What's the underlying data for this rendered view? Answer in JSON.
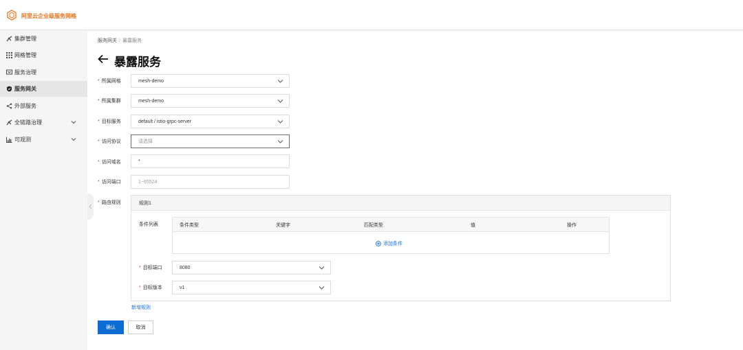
{
  "header": {
    "brand": "阿里云企业级服务网格",
    "brand_color": "#e8741f",
    "logo_icon": "hexagon-logo-icon"
  },
  "sidebar": {
    "items": [
      {
        "label": "集群管理",
        "icon": "cluster-icon",
        "active": false,
        "expandable": false
      },
      {
        "label": "网格管理",
        "icon": "grid-icon",
        "active": false,
        "expandable": false
      },
      {
        "label": "服务治理",
        "icon": "service-icon",
        "active": false,
        "expandable": false
      },
      {
        "label": "服务网关",
        "icon": "shield-icon",
        "active": true,
        "expandable": false
      },
      {
        "label": "外部服务",
        "icon": "share-icon",
        "active": false,
        "expandable": false
      },
      {
        "label": "全链路治理",
        "icon": "cluster-icon",
        "active": false,
        "expandable": true
      },
      {
        "label": "可观测",
        "icon": "chart-icon",
        "active": false,
        "expandable": true
      }
    ]
  },
  "breadcrumb": {
    "parent": "服务网关",
    "separator": "/",
    "current": "暴露服务"
  },
  "page": {
    "title": "暴露服务"
  },
  "form": {
    "mesh": {
      "label": "所属网格",
      "value": "mesh-demo"
    },
    "cluster": {
      "label": "所属集群",
      "value": "mesh-demo"
    },
    "target_service": {
      "label": "目标服务",
      "value": "default / istio-grpc-server"
    },
    "protocol": {
      "label": "访问协议",
      "placeholder": "请选择"
    },
    "domain": {
      "label": "访问域名",
      "value": "*"
    },
    "port": {
      "label": "访问端口",
      "placeholder": "1~65524"
    },
    "routing": {
      "label": "路由规则"
    }
  },
  "rule": {
    "title": "规则1",
    "conditions_label": "条件列表",
    "columns": [
      "条件类型",
      "关键字",
      "匹配类型",
      "值",
      "操作"
    ],
    "add_condition": "添加条件",
    "target_port": {
      "label": "目标端口",
      "value": "8080"
    },
    "target_version": {
      "label": "目标版本",
      "value": "v1"
    }
  },
  "add_rule": "新增规则",
  "buttons": {
    "confirm": "确认",
    "cancel": "取消"
  },
  "colors": {
    "primary": "#0b6dd4",
    "link": "#1a6fd1",
    "required": "#e53935"
  }
}
